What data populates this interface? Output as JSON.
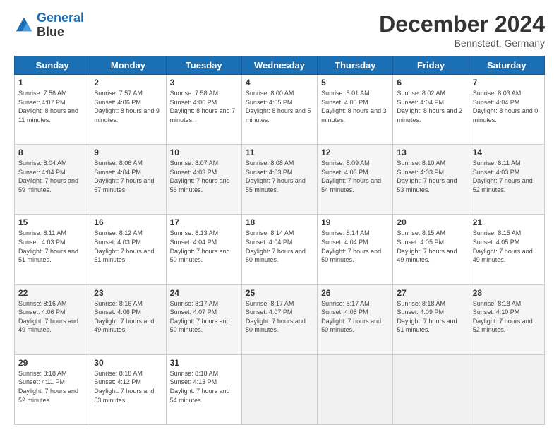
{
  "logo": {
    "line1": "General",
    "line2": "Blue"
  },
  "header": {
    "month": "December 2024",
    "location": "Bennstedt, Germany"
  },
  "weekdays": [
    "Sunday",
    "Monday",
    "Tuesday",
    "Wednesday",
    "Thursday",
    "Friday",
    "Saturday"
  ],
  "weeks": [
    [
      {
        "day": "1",
        "sunrise": "7:56 AM",
        "sunset": "4:07 PM",
        "daylight": "8 hours and 11 minutes."
      },
      {
        "day": "2",
        "sunrise": "7:57 AM",
        "sunset": "4:06 PM",
        "daylight": "8 hours and 9 minutes."
      },
      {
        "day": "3",
        "sunrise": "7:58 AM",
        "sunset": "4:06 PM",
        "daylight": "8 hours and 7 minutes."
      },
      {
        "day": "4",
        "sunrise": "8:00 AM",
        "sunset": "4:05 PM",
        "daylight": "8 hours and 5 minutes."
      },
      {
        "day": "5",
        "sunrise": "8:01 AM",
        "sunset": "4:05 PM",
        "daylight": "8 hours and 3 minutes."
      },
      {
        "day": "6",
        "sunrise": "8:02 AM",
        "sunset": "4:04 PM",
        "daylight": "8 hours and 2 minutes."
      },
      {
        "day": "7",
        "sunrise": "8:03 AM",
        "sunset": "4:04 PM",
        "daylight": "8 hours and 0 minutes."
      }
    ],
    [
      {
        "day": "8",
        "sunrise": "8:04 AM",
        "sunset": "4:04 PM",
        "daylight": "7 hours and 59 minutes."
      },
      {
        "day": "9",
        "sunrise": "8:06 AM",
        "sunset": "4:04 PM",
        "daylight": "7 hours and 57 minutes."
      },
      {
        "day": "10",
        "sunrise": "8:07 AM",
        "sunset": "4:03 PM",
        "daylight": "7 hours and 56 minutes."
      },
      {
        "day": "11",
        "sunrise": "8:08 AM",
        "sunset": "4:03 PM",
        "daylight": "7 hours and 55 minutes."
      },
      {
        "day": "12",
        "sunrise": "8:09 AM",
        "sunset": "4:03 PM",
        "daylight": "7 hours and 54 minutes."
      },
      {
        "day": "13",
        "sunrise": "8:10 AM",
        "sunset": "4:03 PM",
        "daylight": "7 hours and 53 minutes."
      },
      {
        "day": "14",
        "sunrise": "8:11 AM",
        "sunset": "4:03 PM",
        "daylight": "7 hours and 52 minutes."
      }
    ],
    [
      {
        "day": "15",
        "sunrise": "8:11 AM",
        "sunset": "4:03 PM",
        "daylight": "7 hours and 51 minutes."
      },
      {
        "day": "16",
        "sunrise": "8:12 AM",
        "sunset": "4:03 PM",
        "daylight": "7 hours and 51 minutes."
      },
      {
        "day": "17",
        "sunrise": "8:13 AM",
        "sunset": "4:04 PM",
        "daylight": "7 hours and 50 minutes."
      },
      {
        "day": "18",
        "sunrise": "8:14 AM",
        "sunset": "4:04 PM",
        "daylight": "7 hours and 50 minutes."
      },
      {
        "day": "19",
        "sunrise": "8:14 AM",
        "sunset": "4:04 PM",
        "daylight": "7 hours and 50 minutes."
      },
      {
        "day": "20",
        "sunrise": "8:15 AM",
        "sunset": "4:05 PM",
        "daylight": "7 hours and 49 minutes."
      },
      {
        "day": "21",
        "sunrise": "8:15 AM",
        "sunset": "4:05 PM",
        "daylight": "7 hours and 49 minutes."
      }
    ],
    [
      {
        "day": "22",
        "sunrise": "8:16 AM",
        "sunset": "4:06 PM",
        "daylight": "7 hours and 49 minutes."
      },
      {
        "day": "23",
        "sunrise": "8:16 AM",
        "sunset": "4:06 PM",
        "daylight": "7 hours and 49 minutes."
      },
      {
        "day": "24",
        "sunrise": "8:17 AM",
        "sunset": "4:07 PM",
        "daylight": "7 hours and 50 minutes."
      },
      {
        "day": "25",
        "sunrise": "8:17 AM",
        "sunset": "4:07 PM",
        "daylight": "7 hours and 50 minutes."
      },
      {
        "day": "26",
        "sunrise": "8:17 AM",
        "sunset": "4:08 PM",
        "daylight": "7 hours and 50 minutes."
      },
      {
        "day": "27",
        "sunrise": "8:18 AM",
        "sunset": "4:09 PM",
        "daylight": "7 hours and 51 minutes."
      },
      {
        "day": "28",
        "sunrise": "8:18 AM",
        "sunset": "4:10 PM",
        "daylight": "7 hours and 52 minutes."
      }
    ],
    [
      {
        "day": "29",
        "sunrise": "8:18 AM",
        "sunset": "4:11 PM",
        "daylight": "7 hours and 52 minutes."
      },
      {
        "day": "30",
        "sunrise": "8:18 AM",
        "sunset": "4:12 PM",
        "daylight": "7 hours and 53 minutes."
      },
      {
        "day": "31",
        "sunrise": "8:18 AM",
        "sunset": "4:13 PM",
        "daylight": "7 hours and 54 minutes."
      },
      null,
      null,
      null,
      null
    ]
  ]
}
